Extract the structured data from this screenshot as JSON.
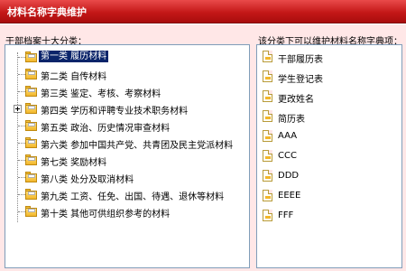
{
  "window": {
    "title": "材料名称字典维护"
  },
  "left_panel": {
    "label": "干部档案十大分类：",
    "items": [
      {
        "label": "第一类  履历材料",
        "selected": true,
        "expandable": false
      },
      {
        "label": "第二类  自传材料",
        "selected": false,
        "expandable": false
      },
      {
        "label": "第三类  鉴定、考核、考察材料",
        "selected": false,
        "expandable": false
      },
      {
        "label": "第四类  学历和评聘专业技术职务材料",
        "selected": false,
        "expandable": true
      },
      {
        "label": "第五类  政治、历史情况审查材料",
        "selected": false,
        "expandable": false
      },
      {
        "label": "第六类  参加中国共产党、共青团及民主党派材料",
        "selected": false,
        "expandable": false
      },
      {
        "label": "第七类  奖励材料",
        "selected": false,
        "expandable": false
      },
      {
        "label": "第八类  处分及取消材料",
        "selected": false,
        "expandable": false
      },
      {
        "label": "第九类  工资、任免、出国、待遇、退休等材料",
        "selected": false,
        "expandable": false
      },
      {
        "label": "第十类  其他可供组织参考的材料",
        "selected": false,
        "expandable": false
      }
    ]
  },
  "right_panel": {
    "label": "该分类下可以维护材料名称字典项：",
    "items": [
      {
        "label": "干部履历表"
      },
      {
        "label": "学生登记表"
      },
      {
        "label": "更改姓名"
      },
      {
        "label": "简历表"
      },
      {
        "label": "AAA"
      },
      {
        "label": "CCC"
      },
      {
        "label": "DDD"
      },
      {
        "label": "EEEE"
      },
      {
        "label": "FFF"
      }
    ]
  },
  "colors": {
    "titlebar": "#c41818",
    "background": "#ffe7e7",
    "selection": "#0a246a",
    "folder": "#f2b62a"
  },
  "icons": {
    "tree_item": "folder-icon",
    "list_item": "document-icon",
    "expander": "plus-expander-icon"
  }
}
